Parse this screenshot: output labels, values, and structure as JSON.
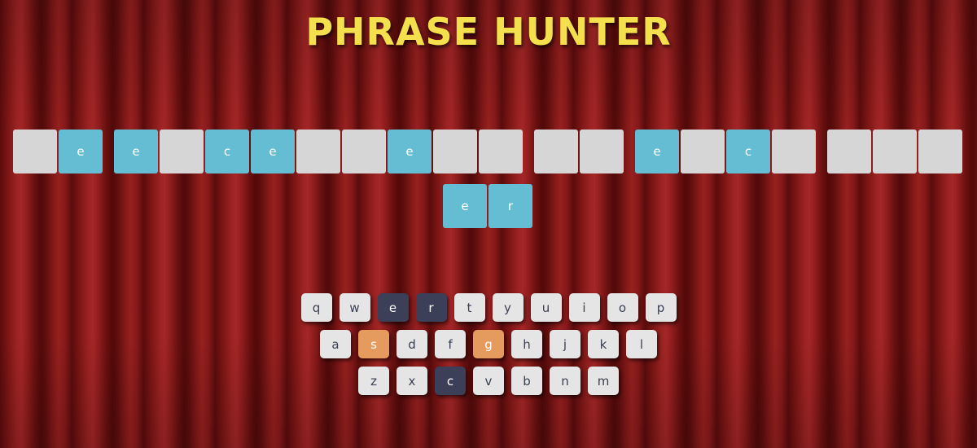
{
  "title": "PHRASE HUNTER",
  "phrase": {
    "rows": [
      [
        [
          {
            "letter": "",
            "shown": false
          },
          {
            "letter": "e",
            "shown": true
          }
        ],
        [
          {
            "letter": "e",
            "shown": true
          },
          {
            "letter": "",
            "shown": false
          },
          {
            "letter": "c",
            "shown": true
          },
          {
            "letter": "e",
            "shown": true
          },
          {
            "letter": "",
            "shown": false
          },
          {
            "letter": "",
            "shown": false
          },
          {
            "letter": "e",
            "shown": true
          },
          {
            "letter": "",
            "shown": false
          },
          {
            "letter": "",
            "shown": false
          }
        ],
        [
          {
            "letter": "",
            "shown": false
          },
          {
            "letter": "",
            "shown": false
          }
        ],
        [
          {
            "letter": "e",
            "shown": true
          },
          {
            "letter": "",
            "shown": false
          },
          {
            "letter": "c",
            "shown": true
          },
          {
            "letter": "",
            "shown": false
          }
        ],
        [
          {
            "letter": "",
            "shown": false
          },
          {
            "letter": "",
            "shown": false
          },
          {
            "letter": "",
            "shown": false
          }
        ]
      ],
      [
        [
          {
            "letter": "e",
            "shown": true
          },
          {
            "letter": "r",
            "shown": true
          }
        ]
      ]
    ]
  },
  "keyboard": {
    "rows": [
      [
        {
          "key": "q",
          "state": "unused"
        },
        {
          "key": "w",
          "state": "unused"
        },
        {
          "key": "e",
          "state": "chosen"
        },
        {
          "key": "r",
          "state": "chosen"
        },
        {
          "key": "t",
          "state": "unused"
        },
        {
          "key": "y",
          "state": "unused"
        },
        {
          "key": "u",
          "state": "unused"
        },
        {
          "key": "i",
          "state": "unused"
        },
        {
          "key": "o",
          "state": "unused"
        },
        {
          "key": "p",
          "state": "unused"
        }
      ],
      [
        {
          "key": "a",
          "state": "unused"
        },
        {
          "key": "s",
          "state": "wrong"
        },
        {
          "key": "d",
          "state": "unused"
        },
        {
          "key": "f",
          "state": "unused"
        },
        {
          "key": "g",
          "state": "wrong"
        },
        {
          "key": "h",
          "state": "unused"
        },
        {
          "key": "j",
          "state": "unused"
        },
        {
          "key": "k",
          "state": "unused"
        },
        {
          "key": "l",
          "state": "unused"
        }
      ],
      [
        {
          "key": "z",
          "state": "unused"
        },
        {
          "key": "x",
          "state": "unused"
        },
        {
          "key": "c",
          "state": "chosen"
        },
        {
          "key": "v",
          "state": "unused"
        },
        {
          "key": "b",
          "state": "unused"
        },
        {
          "key": "n",
          "state": "unused"
        },
        {
          "key": "m",
          "state": "unused"
        }
      ]
    ]
  },
  "colors": {
    "title": "#f4e04d",
    "tile_hidden": "#d6d6d6",
    "tile_shown": "#65bdd3",
    "key_default": "#e5e5e5",
    "key_chosen": "#3b3f57",
    "key_wrong": "#e59a5e",
    "curtain": "#8c1c1c"
  }
}
